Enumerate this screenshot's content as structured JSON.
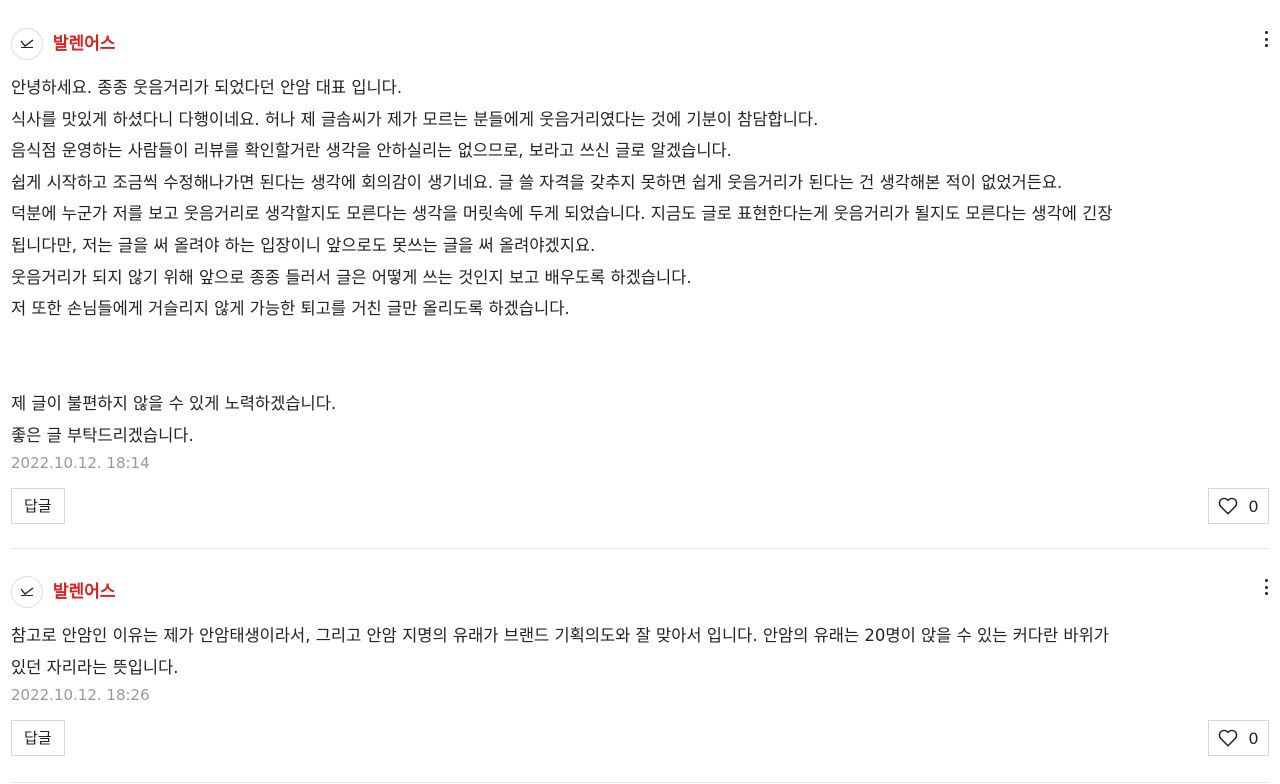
{
  "comments": [
    {
      "author": "발렌어스",
      "lines": [
        "안녕하세요. 종종 웃음거리가 되었다던 안암 대표 입니다.",
        "식사를 맛있게 하셨다니 다행이네요. 허나 제 글솜씨가 제가 모르는 분들에게 웃음거리였다는 것에 기분이 참담합니다.",
        "음식점 운영하는 사람들이 리뷰를 확인할거란 생각을 안하실리는 없으므로, 보라고 쓰신 글로 알겠습니다.",
        "쉽게 시작하고 조금씩 수정해나가면 된다는 생각에 회의감이 생기네요. 글 쓸 자격을 갖추지 못하면 쉽게 웃음거리가 된다는 건 생각해본 적이 없었거든요.",
        "덕분에 누군가 저를 보고 웃음거리로 생각할지도 모른다는 생각을 머릿속에 두게 되었습니다. 지금도 글로 표현한다는게 웃음거리가 될지도 모른다는 생각에 긴장",
        "됩니다만, 저는 글을 써 올려야 하는 입장이니 앞으로도 못쓰는 글을 써 올려야겠지요.",
        "웃음거리가 되지 않기 위해 앞으로 종종 들러서 글은 어떻게 쓰는 것인지 보고 배우도록 하겠습니다.",
        "저 또한 손님들에게 거슬리지 않게 가능한 퇴고를 거친 글만 올리도록 하겠습니다.",
        "",
        "",
        "제 글이 불편하지 않을 수 있게 노력하겠습니다.",
        "좋은 글 부탁드리겠습니다."
      ],
      "date": "2022.10.12. 18:14",
      "reply_label": "답글",
      "like_count": "0"
    },
    {
      "author": "발렌어스",
      "lines": [
        "참고로 안암인 이유는 제가 안암태생이라서, 그리고 안암 지명의 유래가 브랜드 기획의도와 잘 맞아서 입니다. 안암의 유래는 20명이 앉을 수 있는 커다란 바위가",
        "있던 자리라는 뜻입니다."
      ],
      "date": "2022.10.12. 18:26",
      "reply_label": "답글",
      "like_count": "0"
    }
  ],
  "icons": {
    "more": "more-vertical-icon",
    "like": "heart-outline-icon",
    "avatar": "brand-logo"
  },
  "colors": {
    "author": "#e02020",
    "date": "#999999",
    "border": "#d6d6d6"
  }
}
